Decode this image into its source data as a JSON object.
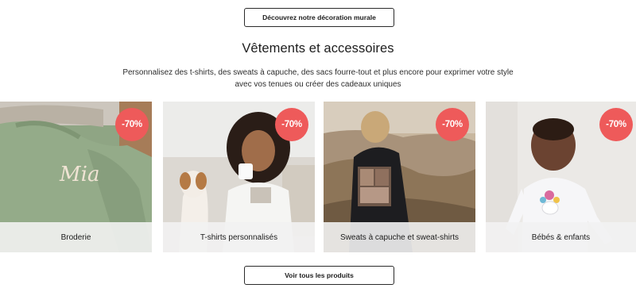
{
  "buttons": {
    "top_label": "Découvrez notre décoration murale",
    "bottom_label": "Voir tous les produits"
  },
  "section": {
    "title": "Vêtements et accessoires",
    "subtitle": "Personnalisez des t-shirts, des sweats à capuche, des sacs fourre-tout et plus encore pour exprimer votre style avec vos tenues ou créer des cadeaux uniques"
  },
  "cards": [
    {
      "label": "Broderie",
      "badge": "-70%",
      "embroidery_text": "Mia"
    },
    {
      "label": "T-shirts personnalisés",
      "badge": "-70%"
    },
    {
      "label": "Sweats à capuche et sweat-shirts",
      "badge": "-70%"
    },
    {
      "label": "Bébés & enfants",
      "badge": "-70%"
    }
  ],
  "colors": {
    "badge": "#ee5a5a",
    "button_border": "#2b2b2b",
    "caption_bg": "#f2f2f2"
  }
}
